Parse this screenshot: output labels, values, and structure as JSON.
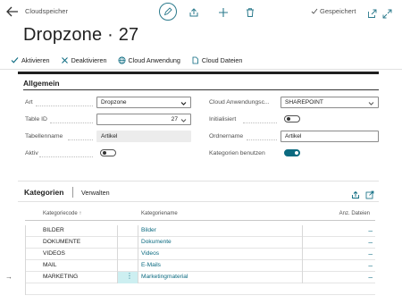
{
  "header": {
    "breadcrumb": "Cloudspeicher",
    "saved_label": "Gespeichert",
    "title": "Dropzone · 27"
  },
  "actions": [
    {
      "label": "Aktivieren",
      "icon": "check-icon"
    },
    {
      "label": "Deaktivieren",
      "icon": "x-icon"
    },
    {
      "label": "Cloud Anwendung",
      "icon": "globe-icon"
    },
    {
      "label": "Cloud Dateien",
      "icon": "document-icon"
    }
  ],
  "general": {
    "heading": "Allgemein",
    "left": {
      "art_label": "Art",
      "art_value": "Dropzone",
      "tableid_label": "Table ID",
      "tableid_value": "27",
      "tabellenname_label": "Tabellenname",
      "tabellenname_value": "Artikel",
      "aktiv_label": "Aktiv",
      "aktiv_on": false
    },
    "right": {
      "cloud_label": "Cloud Anwendungsc...",
      "cloud_value": "SHAREPOINT",
      "init_label": "Initialisiert",
      "init_on": false,
      "ordner_label": "Ordnername",
      "ordner_value": "Artikel",
      "kat_label": "Kategorien benutzen",
      "kat_on": true
    }
  },
  "categories": {
    "heading": "Kategorien",
    "manage_label": "Verwalten",
    "columns": {
      "code": "Kategoriecode ↑",
      "name": "Kategoriename",
      "files": "Anz. Dateien"
    },
    "rows": [
      {
        "code": "BILDER",
        "name": "Bilder",
        "files": "_"
      },
      {
        "code": "DOKUMENTE",
        "name": "Dokumente",
        "files": "_"
      },
      {
        "code": "VIDEOS",
        "name": "Videos",
        "files": "_"
      },
      {
        "code": "MAIL",
        "name": "E-Mails",
        "files": "_"
      },
      {
        "code": "MARKETING",
        "name": "Marketingmaterial",
        "files": "_"
      }
    ]
  },
  "colors": {
    "accent": "#0b6a80",
    "selection": "#cdeff1"
  }
}
